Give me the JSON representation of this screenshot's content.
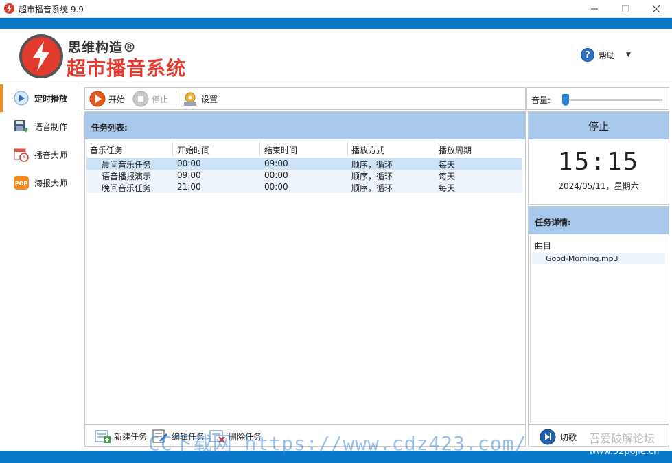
{
  "window": {
    "title": "超市播音系统 9.9"
  },
  "header": {
    "brand_small": "思维构造®",
    "brand_big": "超市播音系统",
    "help_label": "帮助"
  },
  "sidebar": {
    "items": [
      {
        "label": "定时播放",
        "icon": "play-circle-icon",
        "active": true
      },
      {
        "label": "语音制作",
        "icon": "voice-disk-icon",
        "active": false
      },
      {
        "label": "播音大师",
        "icon": "calendar-clock-icon",
        "active": false
      },
      {
        "label": "海报大师",
        "icon": "pop-poster-icon",
        "active": false
      }
    ]
  },
  "toolbar": {
    "start_label": "开始",
    "stop_label": "停止",
    "settings_label": "设置"
  },
  "volume": {
    "label": "音量:",
    "level": 0.0
  },
  "task_list": {
    "title": "任务列表:",
    "columns": [
      "音乐任务",
      "开始时间",
      "结束时间",
      "播放方式",
      "播放周期"
    ],
    "rows": [
      {
        "name": "晨间音乐任务",
        "start": "00:00",
        "end": "09:00",
        "mode": "顺序，循环",
        "cycle": "每天"
      },
      {
        "name": "语音播报演示",
        "start": "09:00",
        "end": "00:00",
        "mode": "顺序，循环",
        "cycle": "每天"
      },
      {
        "name": "晚间音乐任务",
        "start": "21:00",
        "end": "00:00",
        "mode": "顺序，循环",
        "cycle": "每天"
      }
    ]
  },
  "task_actions": {
    "new_label": "新建任务",
    "edit_label": "编辑任务",
    "delete_label": "删除任务"
  },
  "clock": {
    "status": "停止",
    "time": "15:15",
    "date": "2024/05/11，星期六"
  },
  "task_detail": {
    "title": "任务详情:",
    "column": "曲目",
    "tracks": [
      "Good-Morning.mp3"
    ]
  },
  "player": {
    "switch_label": "切歌"
  },
  "watermarks": {
    "center": "CC下载网 https://www.cdz423.com/",
    "right_top": "吾爱破解论坛",
    "right_bottom": "www.52pojie.cn"
  },
  "colors": {
    "accent_blue": "#0a79c9",
    "panel_head": "#a8c8ec",
    "brand_red": "#e23a2e",
    "active_orange": "#f08c1a"
  }
}
